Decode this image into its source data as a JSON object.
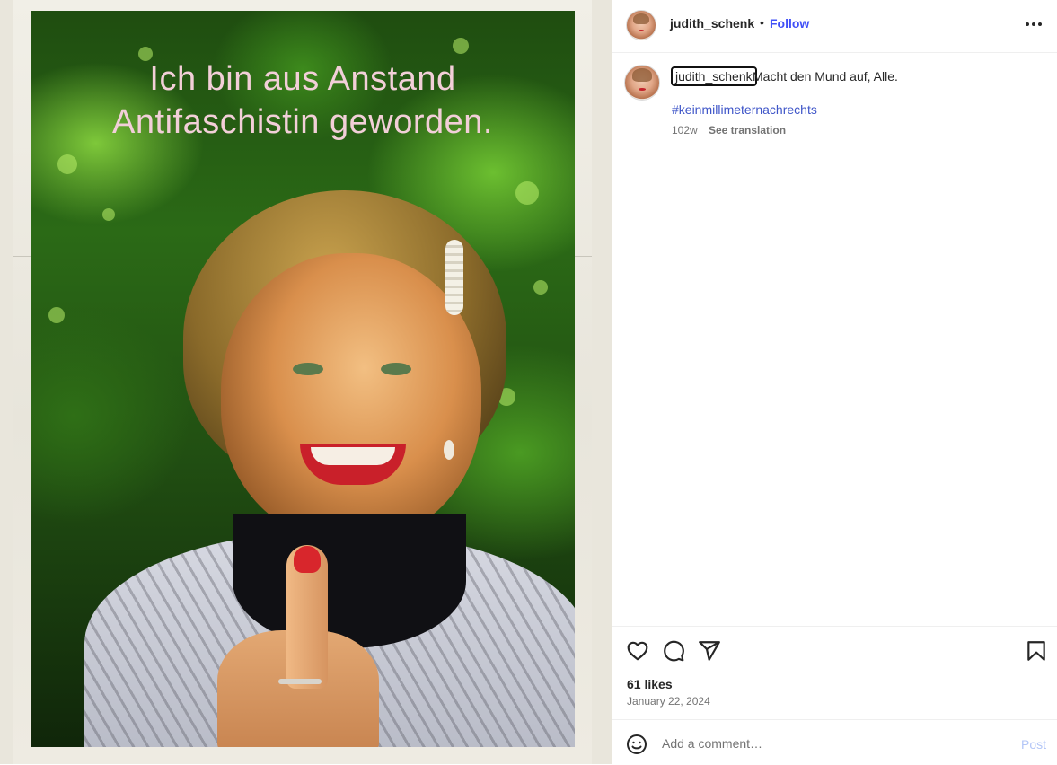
{
  "media": {
    "photo_text_line1": "Ich bin aus Anstand",
    "photo_text_line2": "Antifaschistin geworden."
  },
  "header": {
    "username": "judith_schenk",
    "separator": "•",
    "follow_label": "Follow",
    "more_icon": "more-horizontal-icon"
  },
  "caption": {
    "username": "judith_schenk",
    "text": "Macht den Mund auf, Alle.",
    "hashtag": "#keinmillimeternachrechts",
    "age": "102w",
    "see_translation": "See translation"
  },
  "actions": {
    "icons": [
      "heart-icon",
      "comment-icon",
      "share-icon",
      "bookmark-icon"
    ],
    "likes": "61 likes",
    "date": "January 22, 2024"
  },
  "comment": {
    "placeholder": "Add a comment…",
    "post_label": "Post",
    "emoji_icon": "emoji-icon"
  },
  "colors": {
    "follow": "#4150f7",
    "hashtag": "#3e55c8",
    "post_disabled": "#b3c6f7",
    "muted_text": "#737373"
  }
}
